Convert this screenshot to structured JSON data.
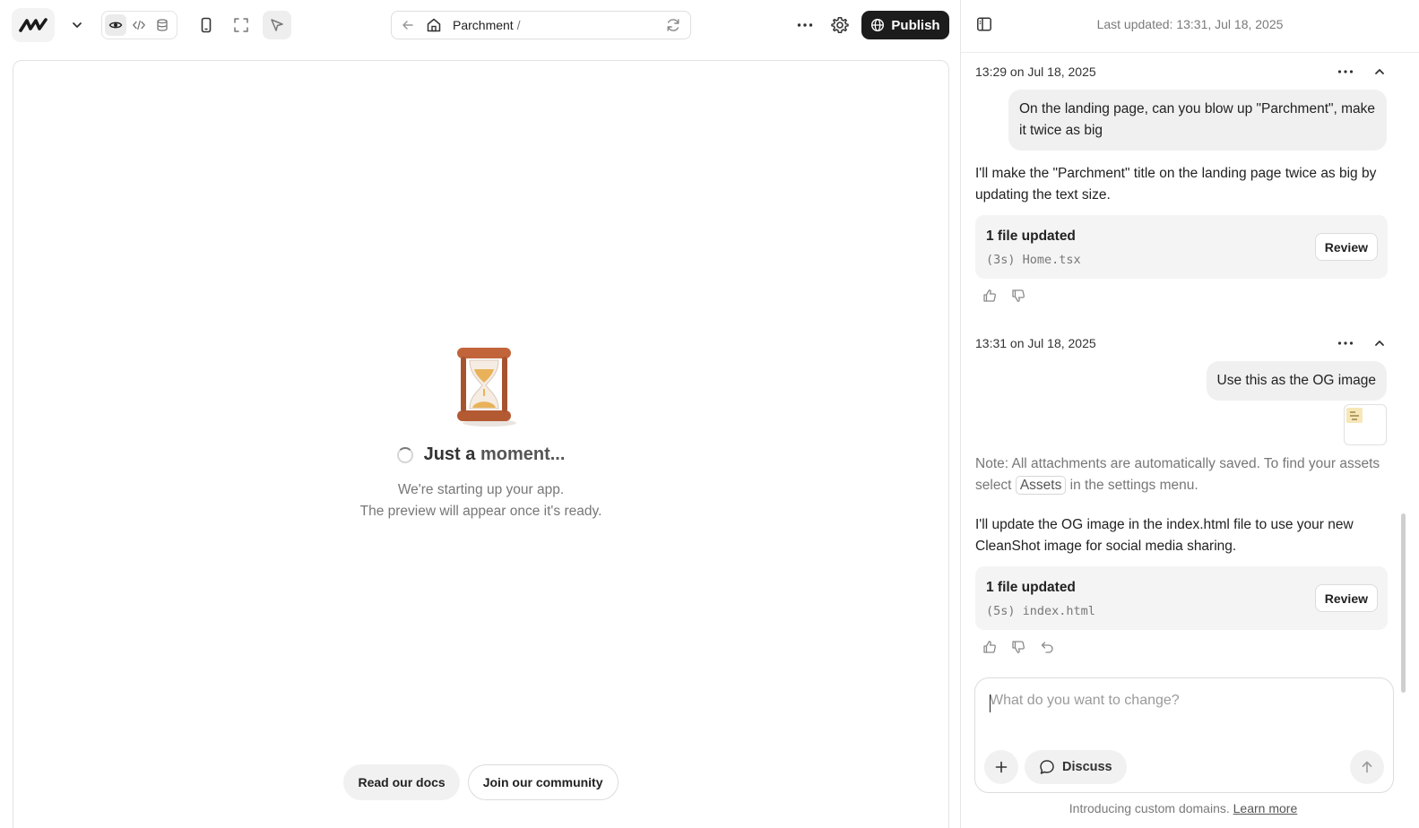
{
  "toolbar": {
    "logo_icon": "brand-logo-icon",
    "url_text": "Parchment",
    "url_suffix": "/",
    "publish_label": "Publish"
  },
  "preview": {
    "title_bold": "Just a",
    "title_rest": "moment...",
    "subtitle_line1": "We're starting up your app.",
    "subtitle_line2": "The preview will appear once it's ready.",
    "docs_label": "Read our docs",
    "community_label": "Join our community"
  },
  "panel": {
    "last_updated": "Last updated: 13:31, Jul 18, 2025",
    "messages": [
      {
        "timestamp": "13:29 on Jul 18, 2025",
        "user_text": "On the landing page, can you blow up \"Parchment\", make it twice as big",
        "assistant_text": "I'll make the \"Parchment\" title on the landing page twice as big by updating the text size.",
        "file_card": {
          "title": "1 file updated",
          "file": "(3s) Home.tsx",
          "review_label": "Review"
        }
      },
      {
        "timestamp": "13:31 on Jul 18, 2025",
        "user_text": "Use this as the OG image",
        "note_prefix": "Note: All attachments are automatically saved. To find your assets select",
        "note_chip": "Assets",
        "note_suffix": "in the settings menu.",
        "assistant_text": "I'll update the OG image in the index.html file to use your new CleanShot image for social media sharing.",
        "file_card": {
          "title": "1 file updated",
          "file": "(5s) index.html",
          "review_label": "Review"
        }
      }
    ],
    "composer": {
      "placeholder": "What do you want to change?",
      "discuss_label": "Discuss"
    },
    "footer": {
      "text": "Introducing custom domains.",
      "link": "Learn more"
    }
  },
  "colors": {
    "publish_bg": "#1c1c1c",
    "accent_text": "#222222",
    "muted_text": "#777777"
  }
}
